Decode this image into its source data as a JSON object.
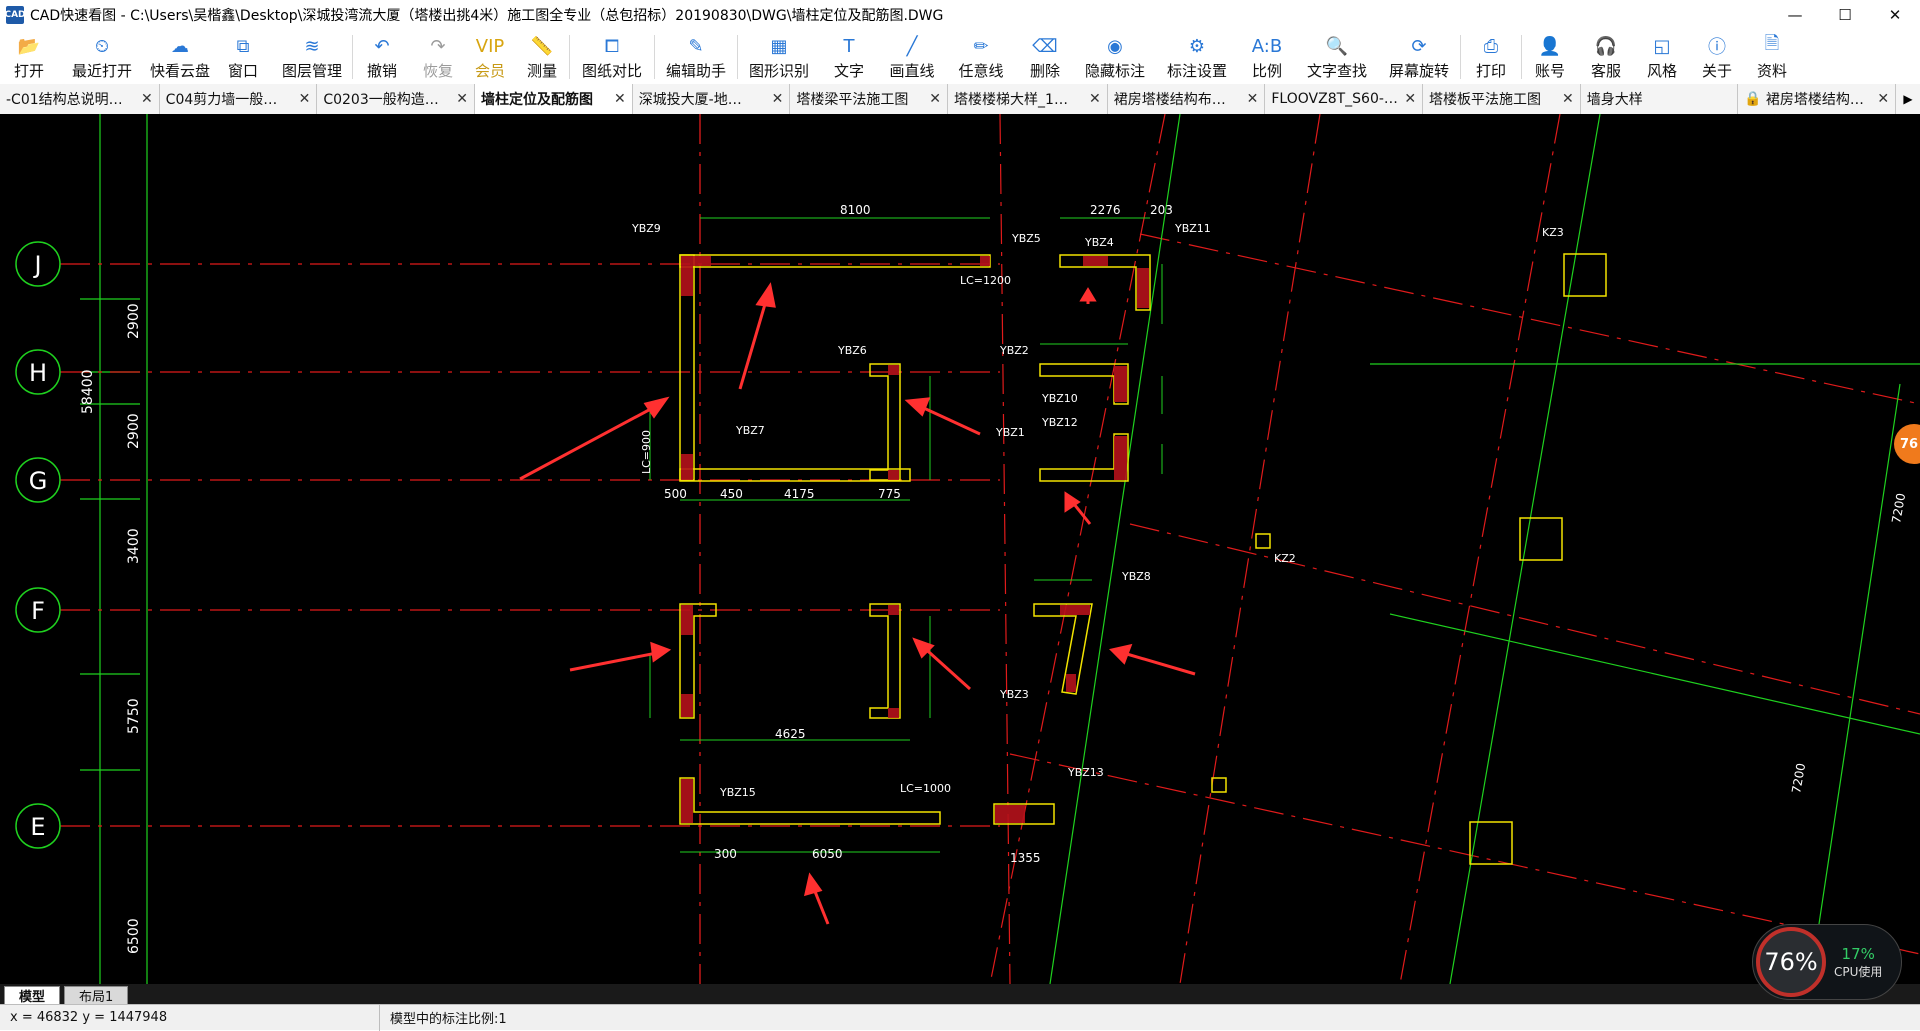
{
  "window": {
    "title": "CAD快速看图 - C:\\Users\\吴楷鑫\\Desktop\\深城投湾流大厦（塔楼出挑4米）施工图全专业（总包招标）20190830\\DWG\\墙柱定位及配筋图.DWG",
    "app_icon_text": "CAD",
    "minimize": "—",
    "maximize": "☐",
    "close": "✕"
  },
  "toolbar": [
    {
      "label": "打开",
      "icon": "folder-open-icon",
      "glyph": "📂"
    },
    {
      "label": "最近打开",
      "icon": "clock-icon",
      "glyph": "⏲"
    },
    {
      "label": "快看云盘",
      "icon": "cloud-icon",
      "glyph": "☁"
    },
    {
      "label": "窗口",
      "icon": "window-icon",
      "glyph": "⧉"
    },
    {
      "label": "图层管理",
      "icon": "layers-icon",
      "glyph": "≋"
    },
    {
      "label": "撤销",
      "icon": "undo-icon",
      "glyph": "↶"
    },
    {
      "label": "恢复",
      "icon": "redo-icon",
      "glyph": "↷"
    },
    {
      "label": "会员",
      "icon": "vip-icon",
      "glyph": "VIP"
    },
    {
      "label": "测量",
      "icon": "ruler-icon",
      "glyph": "📏"
    },
    {
      "label": "图纸对比",
      "icon": "compare-icon",
      "glyph": "⧠"
    },
    {
      "label": "编辑助手",
      "icon": "edit-assistant-icon",
      "glyph": "✎"
    },
    {
      "label": "图形识别",
      "icon": "shape-recognize-icon",
      "glyph": "▦"
    },
    {
      "label": "文字",
      "icon": "text-icon",
      "glyph": "T"
    },
    {
      "label": "画直线",
      "icon": "line-icon",
      "glyph": "╱"
    },
    {
      "label": "任意线",
      "icon": "pencil-icon",
      "glyph": "✏"
    },
    {
      "label": "删除",
      "icon": "eraser-icon",
      "glyph": "⌫"
    },
    {
      "label": "隐藏标注",
      "icon": "eye-hide-icon",
      "glyph": "◉"
    },
    {
      "label": "标注设置",
      "icon": "annotation-settings-icon",
      "glyph": "⚙"
    },
    {
      "label": "比例",
      "icon": "scale-icon",
      "glyph": "A:B"
    },
    {
      "label": "文字查找",
      "icon": "text-search-icon",
      "glyph": "🔍"
    },
    {
      "label": "屏幕旋转",
      "icon": "rotate-screen-icon",
      "glyph": "⟳"
    },
    {
      "label": "打印",
      "icon": "printer-icon",
      "glyph": "⎙"
    },
    {
      "label": "账号",
      "icon": "user-icon",
      "glyph": "👤"
    },
    {
      "label": "客服",
      "icon": "headset-icon",
      "glyph": "🎧"
    },
    {
      "label": "风格",
      "icon": "style-icon",
      "glyph": "◱"
    },
    {
      "label": "关于",
      "icon": "info-icon",
      "glyph": "ⓘ"
    },
    {
      "label": "资料",
      "icon": "document-icon",
      "glyph": "🗎"
    }
  ],
  "tabs": [
    {
      "label": "-C01结构总说明…",
      "active": false
    },
    {
      "label": "C04剪力墙一般…",
      "active": false
    },
    {
      "label": "C0203一般构造…",
      "active": false
    },
    {
      "label": "墙柱定位及配筋图",
      "active": true
    },
    {
      "label": "深城投大厦-地…",
      "active": false
    },
    {
      "label": "塔楼梁平法施工图",
      "active": false
    },
    {
      "label": "塔楼楼梯大样_1…",
      "active": false
    },
    {
      "label": "裙房塔楼结构布…",
      "active": false
    },
    {
      "label": "FLOOVZ8T_S60-…",
      "active": false
    },
    {
      "label": "塔楼板平法施工图",
      "active": false
    },
    {
      "label": "墙身大样",
      "active": false,
      "no_close": true
    },
    {
      "label": "裙房塔楼结构…",
      "active": false,
      "locked": true
    }
  ],
  "tab_more": "▶",
  "drawing": {
    "axis_labels": [
      "J",
      "H",
      "G",
      "F",
      "E"
    ],
    "left_dims": [
      "2900",
      "2900",
      "3400",
      "5750",
      "6500"
    ],
    "total_dim": "58400",
    "top_dims": [
      "8100",
      "2276",
      "203"
    ],
    "wall_labels": [
      "YBZ9",
      "YBZ5",
      "YBZ4",
      "YBZ11",
      "YBZ6",
      "YBZ2",
      "YBZ10",
      "YBZ12",
      "YBZ1",
      "YBZ7",
      "YBZ8",
      "YBZ3",
      "YBZ15",
      "YBZ13",
      "KZ3",
      "KZ2"
    ],
    "bottom_dims": [
      "500",
      "450",
      "4175",
      "775",
      "4625",
      "1355",
      "6050",
      "300"
    ],
    "right_dims": [
      "7200",
      "7200"
    ],
    "lc_labels": [
      "LC=1200",
      "LC=900",
      "LC=1000"
    ]
  },
  "layout_tabs": [
    {
      "label": "模型",
      "active": true
    },
    {
      "label": "布局1",
      "active": false
    }
  ],
  "status": {
    "coords": "x = 46832  y = 1447948",
    "scale": "模型中的标注比例:1"
  },
  "cpu": {
    "ring_value": "76%",
    "usage": "17%",
    "label": "CPU使用"
  },
  "float_badge": "76"
}
